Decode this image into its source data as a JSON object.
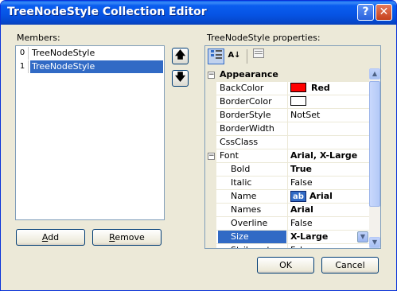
{
  "window": {
    "title": "TreeNodeStyle Collection Editor",
    "help_glyph": "?",
    "close_glyph": "✕"
  },
  "members": {
    "label": "Members:",
    "items": [
      {
        "index": "0",
        "label": "TreeNodeStyle",
        "selected": false
      },
      {
        "index": "1",
        "label": "TreeNodeStyle",
        "selected": true
      }
    ],
    "up_glyph": "🡅",
    "down_glyph": "🡇"
  },
  "buttons": {
    "add_prefix": "",
    "add_mnemonic": "A",
    "add_rest": "dd",
    "remove_mnemonic": "R",
    "remove_rest": "emove",
    "ok": "OK",
    "cancel": "Cancel"
  },
  "properties": {
    "label": "TreeNodeStyle properties:",
    "toolbar": {
      "categorized_icon": "categorized-icon",
      "alphabetical_icon": "alphabetical-icon",
      "pages_icon": "property-pages-icon",
      "alpha_text": "A↓"
    },
    "rows": [
      {
        "type": "cat",
        "expander": "−",
        "name": "Appearance"
      },
      {
        "name": "BackColor",
        "value": "Red",
        "bold": true,
        "swatch": "#ff0000"
      },
      {
        "name": "BorderColor",
        "value": "",
        "swatch": "#ffffff"
      },
      {
        "name": "BorderStyle",
        "value": "NotSet"
      },
      {
        "name": "BorderWidth",
        "value": ""
      },
      {
        "name": "CssClass",
        "value": ""
      },
      {
        "name": "Font",
        "value": "Arial, X-Large",
        "bold": true,
        "expander": "−"
      },
      {
        "name": "Bold",
        "value": "True",
        "bold": true,
        "sub": true
      },
      {
        "name": "Italic",
        "value": "False",
        "sub": true
      },
      {
        "name": "Name",
        "value": "Arial",
        "bold": true,
        "sub": true,
        "fontchip": "ab"
      },
      {
        "name": "Names",
        "value": "Arial",
        "bold": true,
        "sub": true
      },
      {
        "name": "Overline",
        "value": "False",
        "sub": true
      },
      {
        "name": "Size",
        "value": "X-Large",
        "bold": true,
        "sub": true,
        "selected": true
      },
      {
        "name": "Strikeout",
        "value": "False",
        "sub": true
      }
    ],
    "dropdown_glyph": "▼"
  },
  "colors": {
    "selection": "#316ac5",
    "titlebar": "#0a5ef0",
    "red": "#ff0000"
  }
}
